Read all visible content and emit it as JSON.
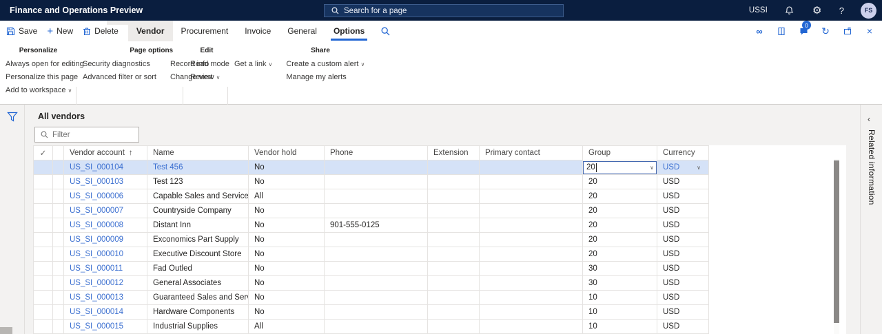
{
  "colors": {
    "topbar": "#0a1e3f",
    "accent": "#2266d3",
    "link": "#3b6fd0",
    "selected_row": "#d5e2f7"
  },
  "topbar": {
    "title": "Finance and Operations Preview",
    "search_placeholder": "Search for a page",
    "company": "USSI",
    "avatar_initials": "FS",
    "icons": [
      "bell-icon",
      "gear-icon",
      "help-icon"
    ]
  },
  "action_pane": {
    "buttons": [
      {
        "label": "Save"
      },
      {
        "label": "New"
      },
      {
        "label": "Delete"
      }
    ],
    "tabs": [
      {
        "label": "Vendor"
      },
      {
        "label": "Procurement"
      },
      {
        "label": "Invoice"
      },
      {
        "label": "General"
      },
      {
        "label": "Options"
      }
    ],
    "messages_badge": "0",
    "right_icons": [
      "attach-icon",
      "task-guide-icon",
      "messages-icon",
      "refresh-icon",
      "open-in-new-window-icon",
      "close-icon"
    ]
  },
  "ribbon": {
    "groups": [
      {
        "title": "Personalize",
        "columns": [
          [
            {
              "label": "Always open for editing"
            },
            {
              "label": "Personalize this page"
            },
            {
              "label": "Add to workspace",
              "dropdown": true
            }
          ]
        ]
      },
      {
        "title": "Page options",
        "columns": [
          [
            {
              "label": "Security diagnostics"
            },
            {
              "label": "Advanced filter or sort"
            }
          ],
          [
            {
              "label": "Record info"
            },
            {
              "label": "Change view",
              "dropdown": true
            }
          ]
        ]
      },
      {
        "title": "Edit",
        "columns": [
          [
            {
              "label": "Read mode"
            },
            {
              "label": "Revert"
            }
          ]
        ]
      },
      {
        "title": "Share",
        "columns": [
          [
            {
              "label": "Get a link",
              "dropdown": true
            }
          ],
          [
            {
              "label": "Create a custom alert",
              "dropdown": true
            },
            {
              "label": "Manage my alerts"
            }
          ]
        ]
      }
    ]
  },
  "content": {
    "view_title": "All vendors",
    "filter_placeholder": "Filter"
  },
  "grid": {
    "columns": [
      "Vendor account",
      "Name",
      "Vendor hold",
      "Phone",
      "Extension",
      "Primary contact",
      "Group",
      "Currency"
    ],
    "sort_column": "Vendor account",
    "sort_direction": "asc",
    "rows": [
      {
        "account": "US_SI_000104",
        "name": "Test 456",
        "hold": "No",
        "phone": "",
        "extension": "",
        "primary_contact": "",
        "group": "20",
        "currency": "USD",
        "selected": true,
        "editing": true
      },
      {
        "account": "US_SI_000103",
        "name": "Test 123",
        "hold": "No",
        "phone": "",
        "extension": "",
        "primary_contact": "",
        "group": "20",
        "currency": "USD"
      },
      {
        "account": "US_SI_000006",
        "name": "Capable Sales and Service",
        "hold": "All",
        "phone": "",
        "extension": "",
        "primary_contact": "",
        "group": "20",
        "currency": "USD"
      },
      {
        "account": "US_SI_000007",
        "name": "Countryside Company",
        "hold": "No",
        "phone": "",
        "extension": "",
        "primary_contact": "",
        "group": "20",
        "currency": "USD"
      },
      {
        "account": "US_SI_000008",
        "name": "Distant Inn",
        "hold": "No",
        "phone": "901-555-0125",
        "extension": "",
        "primary_contact": "",
        "group": "20",
        "currency": "USD"
      },
      {
        "account": "US_SI_000009",
        "name": "Exconomics Part Supply",
        "hold": "No",
        "phone": "",
        "extension": "",
        "primary_contact": "",
        "group": "20",
        "currency": "USD"
      },
      {
        "account": "US_SI_000010",
        "name": "Executive Discount Store",
        "hold": "No",
        "phone": "",
        "extension": "",
        "primary_contact": "",
        "group": "20",
        "currency": "USD"
      },
      {
        "account": "US_SI_000011",
        "name": "Fad Outled",
        "hold": "No",
        "phone": "",
        "extension": "",
        "primary_contact": "",
        "group": "30",
        "currency": "USD"
      },
      {
        "account": "US_SI_000012",
        "name": "General Associates",
        "hold": "No",
        "phone": "",
        "extension": "",
        "primary_contact": "",
        "group": "30",
        "currency": "USD"
      },
      {
        "account": "US_SI_000013",
        "name": "Guaranteed Sales and Service",
        "hold": "No",
        "phone": "",
        "extension": "",
        "primary_contact": "",
        "group": "10",
        "currency": "USD"
      },
      {
        "account": "US_SI_000014",
        "name": "Hardware Components",
        "hold": "No",
        "phone": "",
        "extension": "",
        "primary_contact": "",
        "group": "10",
        "currency": "USD"
      },
      {
        "account": "US_SI_000015",
        "name": "Industrial Supplies",
        "hold": "All",
        "phone": "",
        "extension": "",
        "primary_contact": "",
        "group": "10",
        "currency": "USD"
      }
    ]
  },
  "side_panel": {
    "label": "Related information"
  }
}
